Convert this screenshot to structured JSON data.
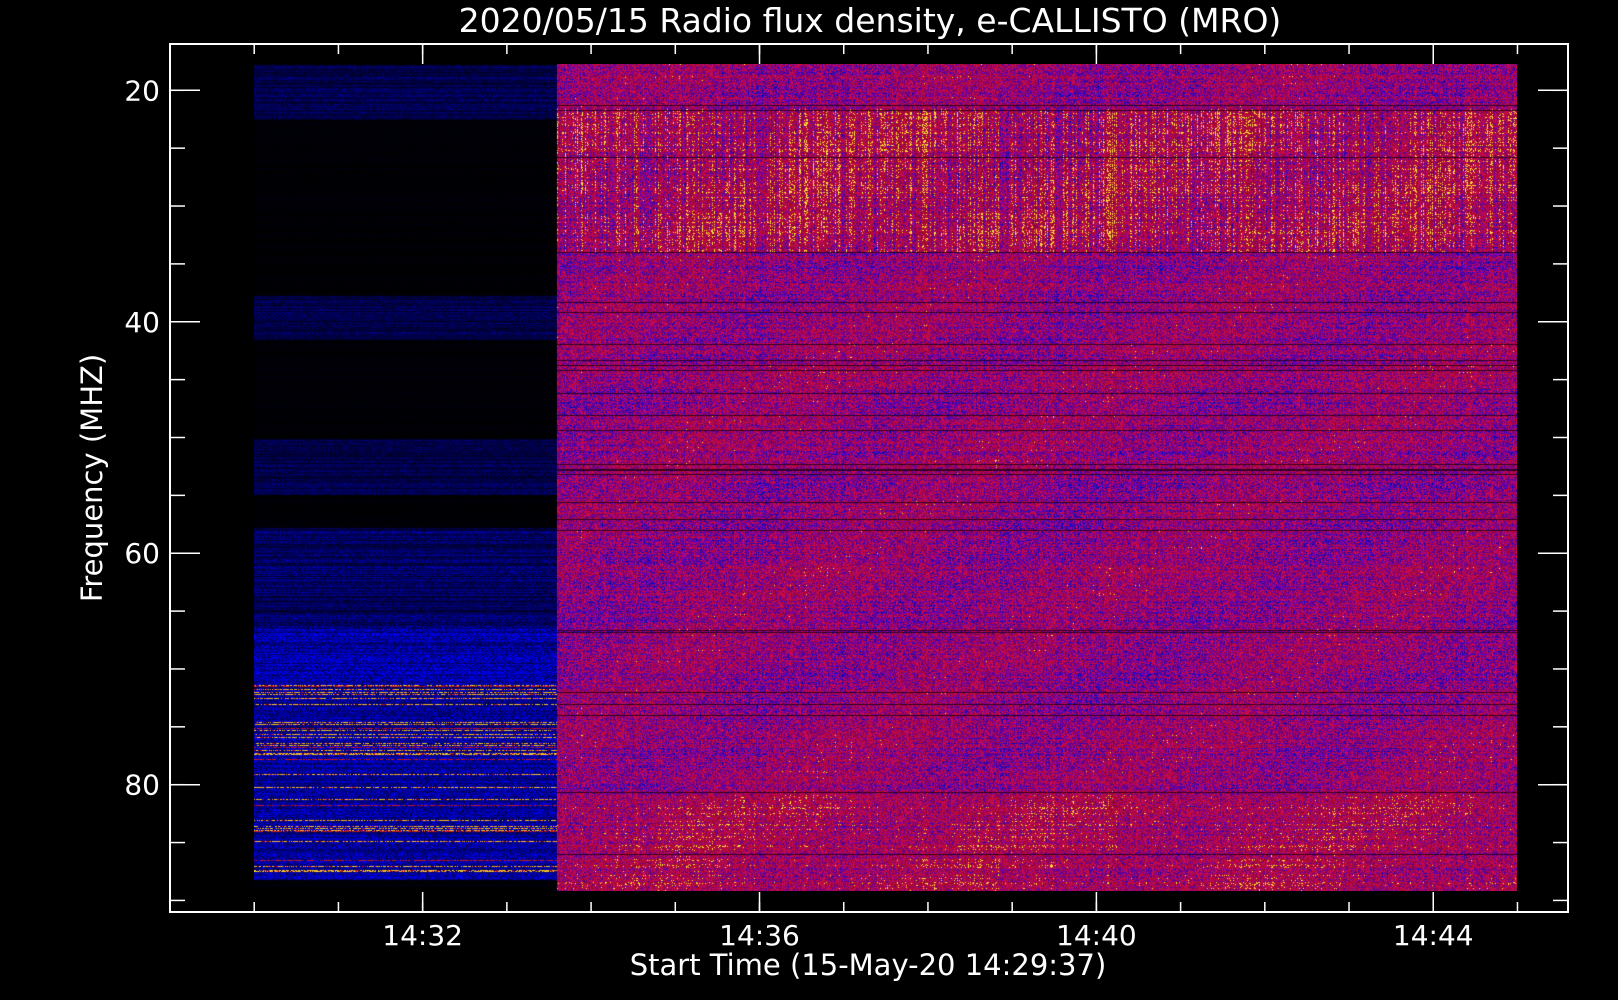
{
  "chart_data": {
    "type": "heatmap",
    "title": "2020/05/15  Radio flux density, e-CALLISTO (MRO)",
    "xlabel": "Start Time (15-May-20 14:29:37)",
    "ylabel": "Frequency (MHZ)",
    "x_ticks": [
      "14:32",
      "14:36",
      "14:40",
      "14:44"
    ],
    "y_ticks": [
      "20",
      "40",
      "60",
      "80"
    ],
    "x_range_minutes": [
      29.0,
      45.6
    ],
    "y_range_mhz": [
      16,
      91
    ],
    "y_axis_inverted": true,
    "data_start_minute": 30,
    "data_end_minute": 45,
    "quiet_period_end_minute": 33.6,
    "colors": {
      "background": "#000000",
      "low": "#0a0a9a",
      "mid": "#1c1cff",
      "high": "#c81e14",
      "peak": "#ffc040",
      "axis": "#ffffff"
    }
  }
}
